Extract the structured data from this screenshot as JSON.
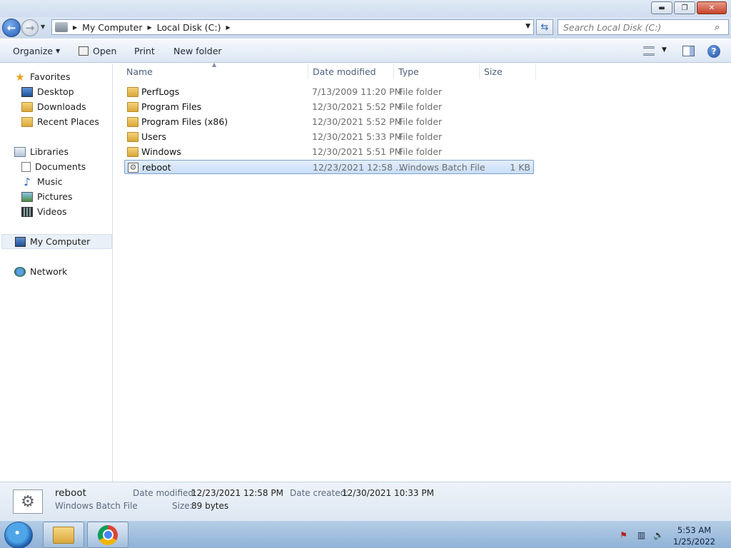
{
  "window": {
    "minimize": "▬",
    "maximize": "❐",
    "close": "✕"
  },
  "address": {
    "crumbs": [
      "My Computer",
      "Local Disk (C:)"
    ],
    "search_placeholder": "Search Local Disk (C:)"
  },
  "toolbar": {
    "organize": "Organize",
    "open": "Open",
    "print": "Print",
    "new_folder": "New folder"
  },
  "nav": {
    "favorites": "Favorites",
    "desktop": "Desktop",
    "downloads": "Downloads",
    "recent_places": "Recent Places",
    "libraries": "Libraries",
    "documents": "Documents",
    "music": "Music",
    "pictures": "Pictures",
    "videos": "Videos",
    "my_computer": "My Computer",
    "network": "Network"
  },
  "columns": {
    "name": "Name",
    "date": "Date modified",
    "type": "Type",
    "size": "Size"
  },
  "files": [
    {
      "name": "PerfLogs",
      "date": "7/13/2009 11:20 PM",
      "type": "File folder",
      "size": "",
      "icon": "folder-icon"
    },
    {
      "name": "Program Files",
      "date": "12/30/2021 5:52 PM",
      "type": "File folder",
      "size": "",
      "icon": "folder-icon"
    },
    {
      "name": "Program Files (x86)",
      "date": "12/30/2021 5:52 PM",
      "type": "File folder",
      "size": "",
      "icon": "folder-icon"
    },
    {
      "name": "Users",
      "date": "12/30/2021 5:33 PM",
      "type": "File folder",
      "size": "",
      "icon": "folder-icon"
    },
    {
      "name": "Windows",
      "date": "12/30/2021 5:51 PM",
      "type": "File folder",
      "size": "",
      "icon": "folder-icon"
    },
    {
      "name": "reboot",
      "date": "12/23/2021 12:58 ...",
      "type": "Windows Batch File",
      "size": "1 KB",
      "icon": "batch-file-icon",
      "selected": true
    }
  ],
  "details": {
    "name": "reboot",
    "type": "Windows Batch File",
    "date_modified_label": "Date modified:",
    "date_modified": "12/23/2021 12:58 PM",
    "date_created_label": "Date created:",
    "date_created": "12/30/2021 10:33 PM",
    "size_label": "Size:",
    "size": "89 bytes"
  },
  "taskbar": {
    "time": "5:53 AM",
    "date": "1/25/2022"
  },
  "colors": {
    "selection": "#cde0f7",
    "chrome_frame": "#cfdcee"
  }
}
